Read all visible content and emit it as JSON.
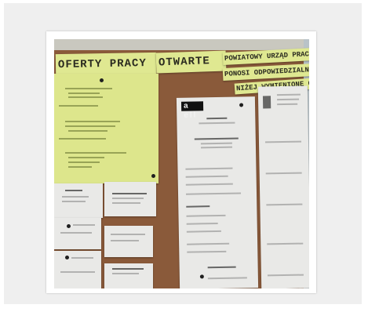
{
  "photo": {
    "description_tags": [
      "notice-board",
      "job-offers",
      "cork-board",
      "paper-notices"
    ]
  },
  "signs": {
    "oferty": "OFERTY PRACY",
    "otwarte": "OTWARTE",
    "urzad": "POWIATOWY URZĄD PRACY",
    "odpowiedzialnosc": "PONOSI ODPOWIEDZIALNOŚ",
    "ponizej": "NIŻEJ WYMIENIONE OFER"
  },
  "notice": {
    "logo": "a ell"
  },
  "colors": {
    "cork": "#8a5a3a",
    "yellow_paper": "#dde68c",
    "white_paper": "#e9e9e7",
    "frame": "#efefef"
  }
}
